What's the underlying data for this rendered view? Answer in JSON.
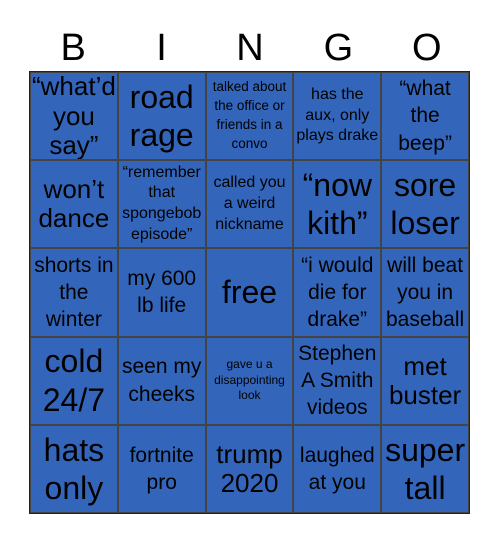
{
  "header": {
    "letters": [
      "B",
      "I",
      "N",
      "G",
      "O"
    ]
  },
  "colors": {
    "cell_bg": "#3366bb",
    "border": "#444444",
    "text": "#000000"
  },
  "cells": [
    {
      "text": "“what’d you say”",
      "size": "s-lg"
    },
    {
      "text": "road rage",
      "size": "s-xl"
    },
    {
      "text": "talked about the office or friends in a convo",
      "size": "s-xs"
    },
    {
      "text": "has the aux, only plays drake",
      "size": "s-sm"
    },
    {
      "text": "“what the beep”",
      "size": "s-md"
    },
    {
      "text": "won’t dance",
      "size": "s-lg"
    },
    {
      "text": "“remember that spongebob episode”",
      "size": "s-sm"
    },
    {
      "text": "called you a weird nickname",
      "size": "s-sm"
    },
    {
      "text": "“now kith”",
      "size": "s-xl"
    },
    {
      "text": "sore loser",
      "size": "s-xl"
    },
    {
      "text": "shorts in the winter",
      "size": "s-md"
    },
    {
      "text": "my 600 lb life",
      "size": "s-md"
    },
    {
      "text": "free",
      "size": "s-xl"
    },
    {
      "text": "“i would die for drake”",
      "size": "s-md"
    },
    {
      "text": "will beat you in baseball",
      "size": "s-md"
    },
    {
      "text": "cold 24/7",
      "size": "s-xl"
    },
    {
      "text": "seen my cheeks",
      "size": "s-md"
    },
    {
      "text": "gave u a disappointing look",
      "size": "s-xxs"
    },
    {
      "text": "Stephen A Smith videos",
      "size": "s-md"
    },
    {
      "text": "met buster",
      "size": "s-lg"
    },
    {
      "text": "hats only",
      "size": "s-xl"
    },
    {
      "text": "fortnite pro",
      "size": "s-md"
    },
    {
      "text": "trump 2020",
      "size": "s-lg"
    },
    {
      "text": "laughed at you",
      "size": "s-md"
    },
    {
      "text": "super tall",
      "size": "s-xl"
    }
  ]
}
